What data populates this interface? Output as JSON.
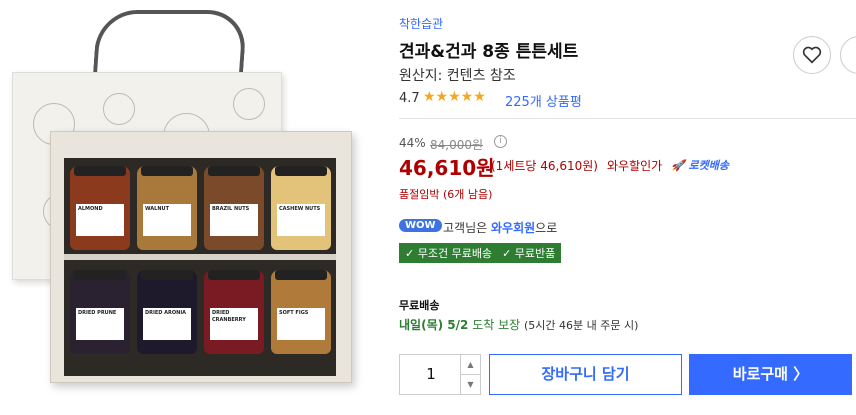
{
  "product": {
    "brand": "착한습관",
    "title": "견과&건과 8종 튼튼세트",
    "origin": "원산지: 컨텐츠 참조",
    "rating": "4.7",
    "stars": "★★★★★",
    "review_count": "225개 상품평"
  },
  "jars": [
    {
      "label": "ALMOND"
    },
    {
      "label": "WALNUT"
    },
    {
      "label": "BRAZIL NUTS"
    },
    {
      "label": "CASHEW NUTS"
    },
    {
      "label": "DRIED PRUNE"
    },
    {
      "label": "DRIED ARONIA"
    },
    {
      "label": "DRIED CRANBERRY"
    },
    {
      "label": "SOFT FIGS"
    }
  ],
  "price": {
    "discount": "44%",
    "original": "84,000원",
    "current": "46,610원",
    "unit": "(1세트당 46,610원)",
    "wow_label": "와우할인가",
    "rocket_label": "🚀 로켓배송"
  },
  "stock": "품절임박 (6개 남음)",
  "wow": {
    "badge": "WOW",
    "text_prefix": "고객님은",
    "text_highlight": "와우회원",
    "text_suffix": "으로"
  },
  "benefits": [
    "무조건 무료배송",
    "무료반품"
  ],
  "shipping": {
    "title": "무료배송",
    "date": "내일(목) 5/2",
    "guarantee": "도착 보장",
    "note": "(5시간 46분 내 주문 시)"
  },
  "actions": {
    "quantity": "1",
    "cart": "장바구니 담기",
    "buy": "바로구매 〉"
  },
  "colors": {
    "accent": "#346aff",
    "price_red": "#ae0000",
    "benefit_green": "#2e7d32"
  }
}
